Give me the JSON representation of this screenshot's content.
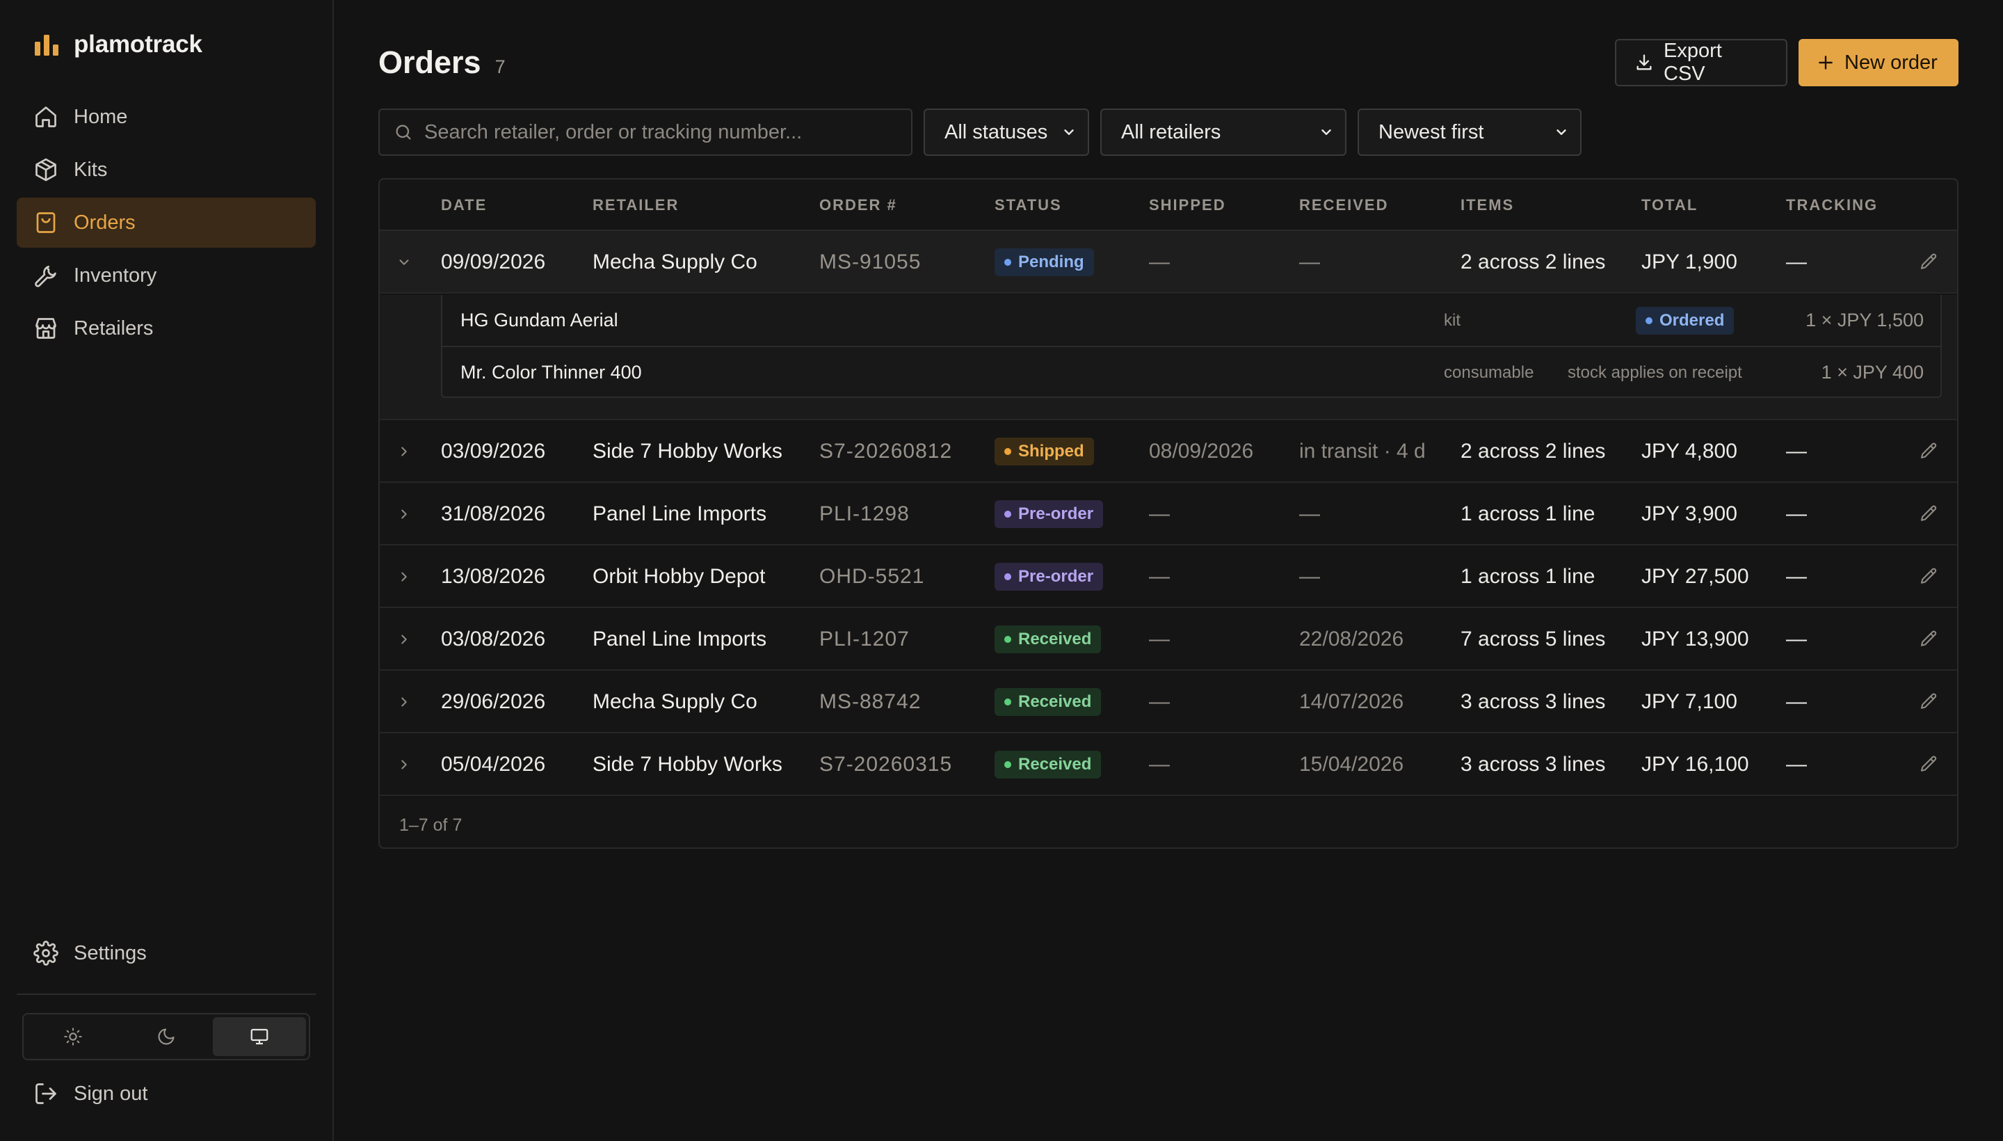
{
  "sidebar": {
    "brand": "plamotrack",
    "nav": [
      {
        "label": "Home",
        "icon": "home-icon"
      },
      {
        "label": "Kits",
        "icon": "box-icon"
      },
      {
        "label": "Orders",
        "icon": "bag-icon",
        "active": true
      },
      {
        "label": "Inventory",
        "icon": "wrench-icon"
      },
      {
        "label": "Retailers",
        "icon": "store-icon"
      }
    ],
    "settings_label": "Settings",
    "signout_label": "Sign out",
    "theme_options": [
      "light",
      "dark",
      "system"
    ],
    "theme_selected": "system"
  },
  "header": {
    "title": "Orders",
    "count": "7",
    "export_label": "Export CSV",
    "new_order_label": "New order"
  },
  "filters": {
    "search_placeholder": "Search retailer, order or tracking number...",
    "status": "All statuses",
    "retailer": "All retailers",
    "sort": "Newest first"
  },
  "table": {
    "columns": [
      "Date",
      "Retailer",
      "Order #",
      "Status",
      "Shipped",
      "Received",
      "Items",
      "Total",
      "Tracking"
    ],
    "rows": [
      {
        "date": "09/09/2026",
        "retailer": "Mecha Supply Co",
        "order": "MS-91055",
        "status": "Pending",
        "shipped": "—",
        "received": "—",
        "items": "2 across 2 lines",
        "total": "JPY 1,900",
        "tracking": "—",
        "expanded": true
      },
      {
        "date": "03/09/2026",
        "retailer": "Side 7 Hobby Works",
        "order": "S7-20260812",
        "status": "Shipped",
        "shipped": "08/09/2026",
        "received": "in transit · 4 d",
        "items": "2 across 2 lines",
        "total": "JPY 4,800",
        "tracking": "—"
      },
      {
        "date": "31/08/2026",
        "retailer": "Panel Line Imports",
        "order": "PLI-1298",
        "status": "Pre-order",
        "shipped": "—",
        "received": "—",
        "items": "1 across 1 line",
        "total": "JPY 3,900",
        "tracking": "—"
      },
      {
        "date": "13/08/2026",
        "retailer": "Orbit Hobby Depot",
        "order": "OHD-5521",
        "status": "Pre-order",
        "shipped": "—",
        "received": "—",
        "items": "1 across 1 line",
        "total": "JPY 27,500",
        "tracking": "—"
      },
      {
        "date": "03/08/2026",
        "retailer": "Panel Line Imports",
        "order": "PLI-1207",
        "status": "Received",
        "shipped": "—",
        "received": "22/08/2026",
        "items": "7 across 5 lines",
        "total": "JPY 13,900",
        "tracking": "—"
      },
      {
        "date": "29/06/2026",
        "retailer": "Mecha Supply Co",
        "order": "MS-88742",
        "status": "Received",
        "shipped": "—",
        "received": "14/07/2026",
        "items": "3 across 3 lines",
        "total": "JPY 7,100",
        "tracking": "—"
      },
      {
        "date": "05/04/2026",
        "retailer": "Side 7 Hobby Works",
        "order": "S7-20260315",
        "status": "Received",
        "shipped": "—",
        "received": "15/04/2026",
        "items": "3 across 3 lines",
        "total": "JPY 16,100",
        "tracking": "—"
      }
    ],
    "expanded_lines": [
      {
        "name": "HG Gundam Aerial",
        "category": "kit",
        "badge": "Ordered",
        "qty": "1 × JPY 1,500"
      },
      {
        "name": "Mr. Color Thinner 400",
        "category": "consumable",
        "note": "stock applies on receipt",
        "qty": "1 × JPY 400"
      }
    ],
    "footer": "1–7 of 7"
  },
  "status_colors": {
    "Pending": {
      "bg": "#1e2a3d",
      "fg": "#8fb4f0",
      "dot": "#6e9ff0"
    },
    "Shipped": {
      "bg": "#3a2c14",
      "fg": "#f0b04f",
      "dot": "#f0a43a"
    },
    "Pre-order": {
      "bg": "#2c2640",
      "fg": "#b8a6f0",
      "dot": "#a894f0"
    },
    "Received": {
      "bg": "#1d3322",
      "fg": "#86d49a",
      "dot": "#5ccf7b"
    },
    "Ordered": {
      "bg": "#1e2a3d",
      "fg": "#8fb4f0",
      "dot": "#6e9ff0"
    }
  },
  "accent": "#e6a545"
}
